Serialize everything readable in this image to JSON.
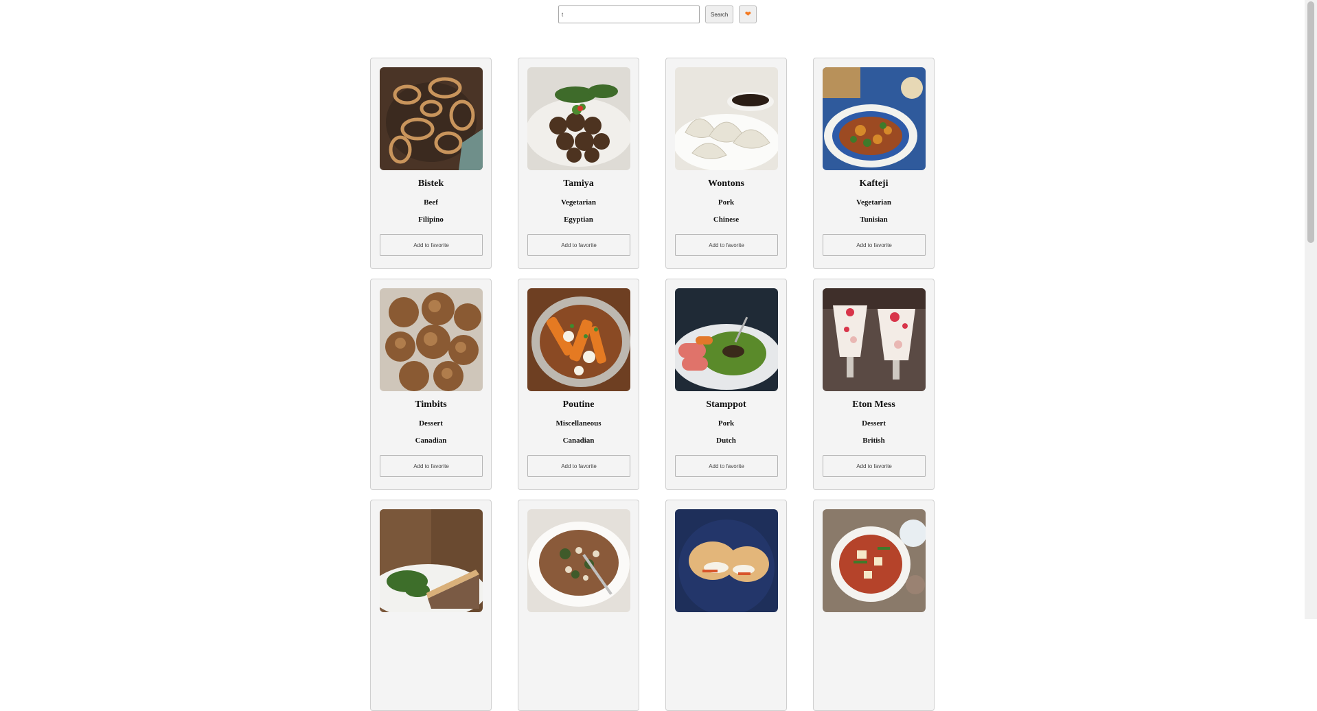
{
  "search": {
    "value": "t",
    "button_label": "Search",
    "favorites_icon": "heart-icon",
    "accent_color": "#f47a21"
  },
  "meals": [
    {
      "name": "Bistek",
      "category": "Beef",
      "area": "Filipino",
      "button_label": "Add to favorite"
    },
    {
      "name": "Tamiya",
      "category": "Vegetarian",
      "area": "Egyptian",
      "button_label": "Add to favorite"
    },
    {
      "name": "Wontons",
      "category": "Pork",
      "area": "Chinese",
      "button_label": "Add to favorite"
    },
    {
      "name": "Kafteji",
      "category": "Vegetarian",
      "area": "Tunisian",
      "button_label": "Add to favorite"
    },
    {
      "name": "Timbits",
      "category": "Dessert",
      "area": "Canadian",
      "button_label": "Add to favorite"
    },
    {
      "name": "Poutine",
      "category": "Miscellaneous",
      "area": "Canadian",
      "button_label": "Add to favorite"
    },
    {
      "name": "Stamppot",
      "category": "Pork",
      "area": "Dutch",
      "button_label": "Add to favorite"
    },
    {
      "name": "Eton Mess",
      "category": "Dessert",
      "area": "British",
      "button_label": "Add to favorite"
    },
    {
      "name": "",
      "category": "",
      "area": "",
      "button_label": ""
    },
    {
      "name": "",
      "category": "",
      "area": "",
      "button_label": ""
    },
    {
      "name": "",
      "category": "",
      "area": "",
      "button_label": ""
    },
    {
      "name": "",
      "category": "",
      "area": "",
      "button_label": ""
    }
  ]
}
